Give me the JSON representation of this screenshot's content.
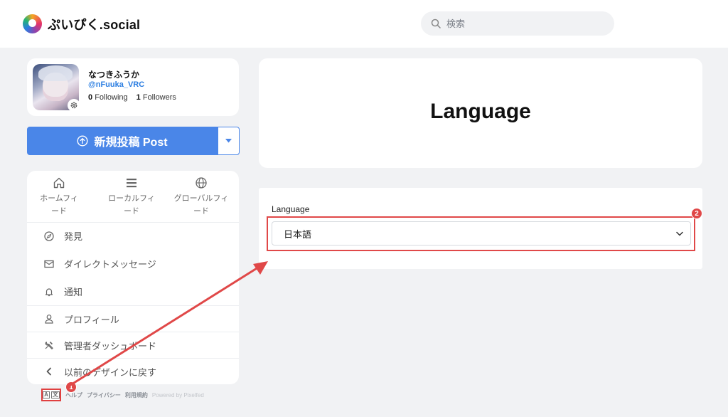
{
  "brand": {
    "name": "ぷいぴく.social"
  },
  "search": {
    "placeholder": "検索"
  },
  "profile": {
    "display_name": "なつきふうか",
    "handle": "@nFuuka_VRC",
    "following_count": "0",
    "following_label": "Following",
    "followers_count": "1",
    "followers_label": "Followers"
  },
  "post_button": {
    "label": "新規投稿 Post"
  },
  "feeds": [
    {
      "label_line1": "ホームフィ",
      "label_line2": "ード",
      "icon": "home-icon"
    },
    {
      "label_line1": "ローカルフィ",
      "label_line2": "ード",
      "icon": "list-icon"
    },
    {
      "label_line1": "グローバルフィ",
      "label_line2": "ード",
      "icon": "globe-icon"
    }
  ],
  "menu": [
    {
      "label": "発見",
      "icon": "compass-icon"
    },
    {
      "label": "ダイレクトメッセージ",
      "icon": "envelope-icon"
    },
    {
      "label": "通知",
      "icon": "bell-icon"
    },
    {
      "label": "プロフィール",
      "icon": "user-icon"
    },
    {
      "label": "管理者ダッシュボード",
      "icon": "tools-icon"
    },
    {
      "label": "以前のデザインに戻す",
      "icon": "chevron-left-icon"
    }
  ],
  "footer": {
    "help": "ヘルプ",
    "privacy": "プライバシー",
    "terms": "利用規約",
    "powered": "Powered by Pixelfed"
  },
  "page": {
    "title": "Language"
  },
  "language_setting": {
    "label": "Language",
    "selected": "日本語"
  },
  "annotations": {
    "step1": "1",
    "step2": "2",
    "color": "#e04848"
  },
  "colors": {
    "accent": "#4a86e8",
    "link": "#2a7de1",
    "background": "#f1f2f4"
  }
}
